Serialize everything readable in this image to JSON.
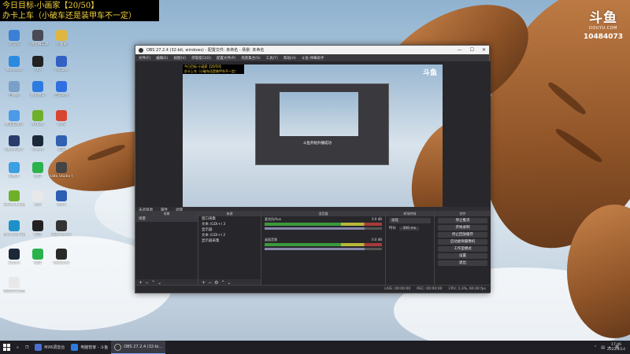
{
  "overlay": {
    "line1": "今日目标-小画家【20/50】",
    "line2": "办卡上车（小破车还是装甲车不一定）"
  },
  "watermark": {
    "logo": "斗鱼",
    "site": "DOUYU.COM",
    "room_id": "10484073"
  },
  "desktop_icons": [
    {
      "label": "此电脑",
      "color": "#3b7fd6"
    },
    {
      "label": "一键直播工具",
      "color": "#4a4a55"
    },
    {
      "label": "小画家",
      "color": "#e0b640"
    },
    {
      "label": "Microsoft",
      "color": "#2a8ae0"
    },
    {
      "label": "QQ",
      "color": "#222"
    },
    {
      "label": "VSCode",
      "color": "#3361c2"
    },
    {
      "label": "回收站",
      "color": "#7aa0c8"
    },
    {
      "label": "腾讯会议",
      "color": "#2d7be0"
    },
    {
      "label": "百度网盘",
      "color": "#2f6fe0"
    },
    {
      "label": "此电脑备份",
      "color": "#4c9ae8"
    },
    {
      "label": "NVIDIA",
      "color": "#6fb02a"
    },
    {
      "label": "WPS",
      "color": "#d84530"
    },
    {
      "label": "BandiCam",
      "color": "#2a3c6a"
    },
    {
      "label": "Steam",
      "color": "#1b2838"
    },
    {
      "label": "设置",
      "color": "#3060b0"
    },
    {
      "label": "记事本",
      "color": "#3aa0e0"
    },
    {
      "label": "微信",
      "color": "#2bb24c"
    },
    {
      "label": "OBS Studio 快捷方式",
      "color": "#444"
    },
    {
      "label": "GeForce Experience",
      "color": "#6fb02a"
    },
    {
      "label": "文件",
      "color": "#e8e8e8"
    },
    {
      "label": "Word",
      "color": "#2b5fb4"
    },
    {
      "label": "Microsoft Edge",
      "color": "#1e90c8"
    },
    {
      "label": "抖音",
      "color": "#222"
    },
    {
      "label": "OBS Studio",
      "color": "#333"
    },
    {
      "label": "Steam",
      "color": "#1b2838"
    },
    {
      "label": "微信",
      "color": "#2bb24c"
    },
    {
      "label": "WeGame",
      "color": "#2a2a2a"
    },
    {
      "label": "新建文本文档",
      "color": "#e8e8e8"
    }
  ],
  "obs": {
    "title": "OBS 27.2.4 (32-bit, windows) - 配置文件: 未命名 - 场景: 未命名",
    "menu": [
      "文件(F)",
      "编辑(E)",
      "视图(V)",
      "停靠窗口(D)",
      "配置文件(P)",
      "场景集合(S)",
      "工具(T)",
      "帮助(H)",
      "斗鱼-弹幕助手"
    ],
    "status_tabs": [
      "未选择源",
      "属性",
      "滤镜"
    ],
    "docks": {
      "scenes": {
        "header": "场景",
        "items": [
          "场景"
        ]
      },
      "sources": {
        "header": "来源",
        "items": [
          "窗口采集",
          "文本 (GDI+) 3",
          "显示器",
          "文本 (GDI+) 2",
          "显示器采集"
        ]
      },
      "mixer": {
        "header": "混音器",
        "channels": [
          {
            "name": "麦克风/Aux",
            "db": "0.0 dB"
          },
          {
            "name": "桌面音频",
            "db": "0.0 dB"
          }
        ]
      },
      "transitions": {
        "header": "转场特效",
        "type": "淡化",
        "duration_label": "时长",
        "duration": "300 ms"
      },
      "controls": {
        "header": "控件",
        "buttons": [
          "停止推流",
          "开始录制",
          "停止回放缓存",
          "启动虚拟摄像机",
          "工作室模式",
          "设置",
          "退出"
        ]
      }
    },
    "status_bar": [
      "LIVE: 00:00:00",
      "REC: 00:00:00",
      "CPU: 1.3%, 60.00 fps"
    ],
    "nested_text": "斗鱼开始升播成功"
  },
  "taskbar": {
    "items": [
      {
        "label": "MX6调音台",
        "color": "#4a6fd0"
      },
      {
        "label": "电脑管家 - 斗鱼",
        "color": "#2d7be0"
      },
      {
        "label": "OBS 27.2.4 (32-bi...",
        "color": "#333"
      }
    ],
    "time": "17:46",
    "date": "2022/4/14",
    "tray_text": "英"
  }
}
